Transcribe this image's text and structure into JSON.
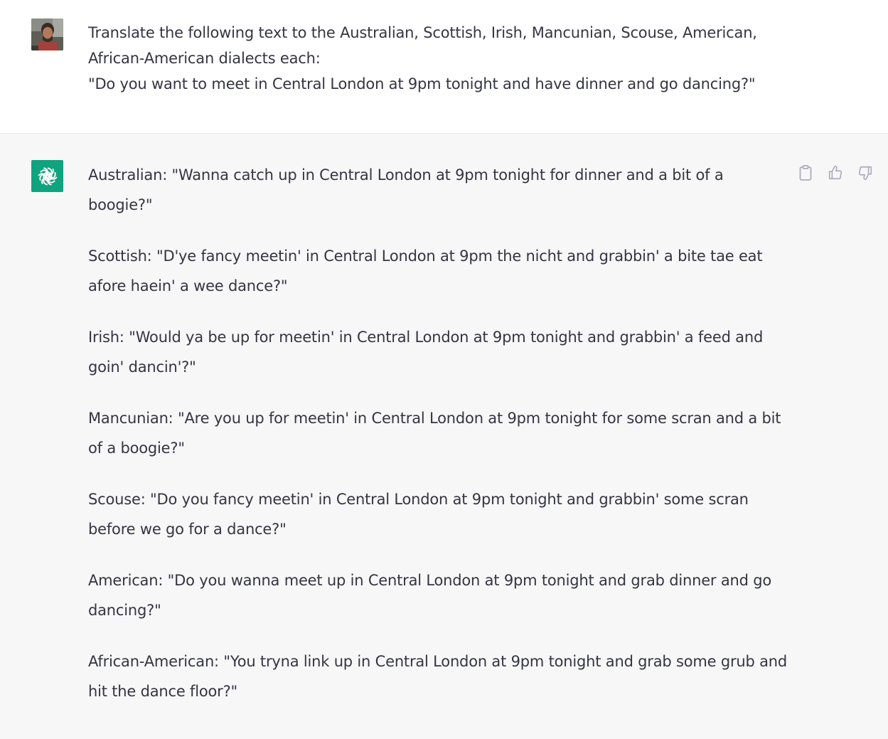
{
  "user_message": {
    "lines": [
      "Translate the following text to the Australian, Scottish, Irish, Mancunian, Scouse, American,",
      "African-American dialects each:",
      "\"Do you want to meet in Central London at 9pm tonight and have dinner and go dancing?\""
    ]
  },
  "assistant_message": {
    "paragraphs": [
      "Australian: \"Wanna catch up in Central London at 9pm tonight for dinner and a bit of a boogie?\"",
      "Scottish: \"D'ye fancy meetin' in Central London at 9pm the nicht and grabbin' a bite tae eat afore haein' a wee dance?\"",
      "Irish: \"Would ya be up for meetin' in Central London at 9pm tonight and grabbin' a feed and goin' dancin'?\"",
      "Mancunian: \"Are you up for meetin' in Central London at 9pm tonight for some scran and a bit of a boogie?\"",
      "Scouse: \"Do you fancy meetin' in Central London at 9pm tonight and grabbin' some scran before we go for a dance?\"",
      "American: \"Do you wanna meet up in Central London at 9pm tonight and grab dinner and go dancing?\"",
      "African-American: \"You tryna link up in Central London at 9pm tonight and grab some grub and hit the dance floor?\""
    ]
  },
  "icons": {
    "user_avatar": "user-photo-avatar",
    "assistant_avatar": "openai-logo-icon",
    "copy": "clipboard-icon",
    "like": "thumbs-up-icon",
    "dislike": "thumbs-down-icon"
  },
  "colors": {
    "text": "#343541",
    "assistant_bg": "#f7f7f8",
    "bot_avatar_bg": "#10a37f",
    "icon": "#acacbe"
  }
}
